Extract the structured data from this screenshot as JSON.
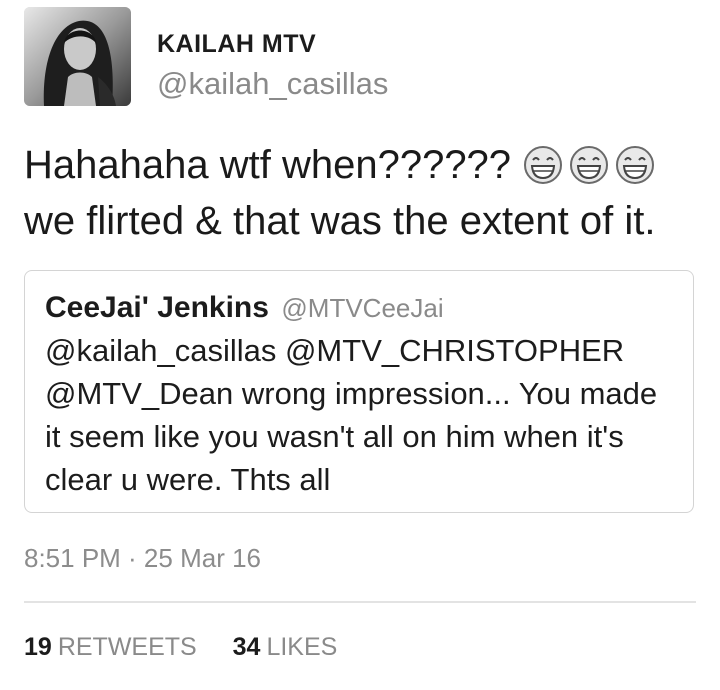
{
  "author": {
    "display_name": "KAILAH MTV",
    "handle": "@kailah_casillas"
  },
  "tweet": {
    "line1": "Hahahaha wtf when??????",
    "emoji_icons": [
      "grinning-face-icon",
      "grinning-face-icon",
      "grinning-face-icon"
    ],
    "line2": "we flirted & that was the extent of it."
  },
  "quoted_tweet": {
    "name": "CeeJai' Jenkins",
    "handle": "@MTVCeeJai",
    "lines": [
      "@kailah_casillas @MTV_CHRISTOPHER",
      "@MTV_Dean wrong impression... You made",
      "it seem like you wasn't all on him when it's",
      "clear u were. Thts all"
    ]
  },
  "timestamp": "8:51 PM · 25 Mar 16",
  "stats": {
    "retweets_count": "19",
    "retweets_label": "RETWEETS",
    "likes_count": "34",
    "likes_label": "LIKES"
  }
}
